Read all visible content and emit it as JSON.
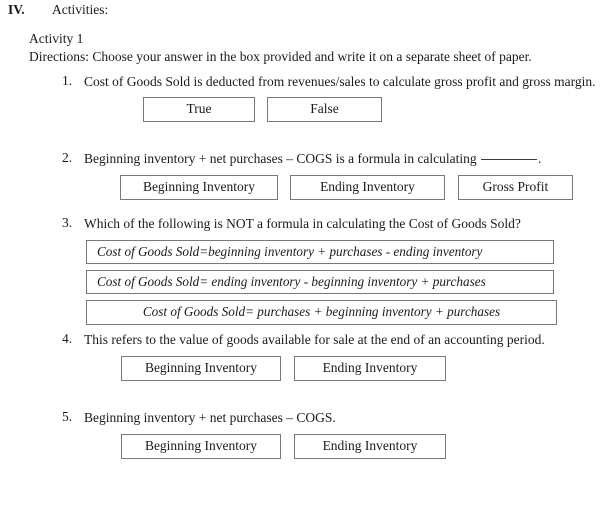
{
  "section": {
    "numeral": "IV.",
    "title": "Activities:"
  },
  "activity": {
    "label": "Activity 1",
    "directions": "Directions: Choose your answer in the box provided and write it on a separate sheet of paper."
  },
  "questions": [
    {
      "number": "1.",
      "text": "Cost of Goods Sold is deducted from revenues/sales to calculate gross profit and gross margin.",
      "options": [
        "True",
        "False"
      ]
    },
    {
      "number": "2.",
      "text_before_blank": "Beginning inventory + net purchases – COGS is a formula in calculating ",
      "text_after_blank": ".",
      "options": [
        "Beginning Inventory",
        "Ending Inventory",
        "Gross Profit"
      ]
    },
    {
      "number": "3.",
      "text": "Which of the following is NOT a formula in calculating the Cost of Goods Sold?",
      "formulas": [
        "Cost of Goods Sold=beginning inventory + purchases - ending inventory",
        "Cost of Goods Sold= ending inventory - beginning inventory + purchases",
        "Cost of Goods Sold= purchases + beginning inventory + purchases"
      ]
    },
    {
      "number": "4.",
      "text": "This refers to the value of goods available for sale at the end of an accounting period.",
      "options": [
        "Beginning Inventory",
        "Ending Inventory"
      ]
    },
    {
      "number": "5.",
      "text": "Beginning inventory + net purchases – COGS.",
      "options": [
        "Beginning Inventory",
        "Ending Inventory"
      ]
    }
  ]
}
